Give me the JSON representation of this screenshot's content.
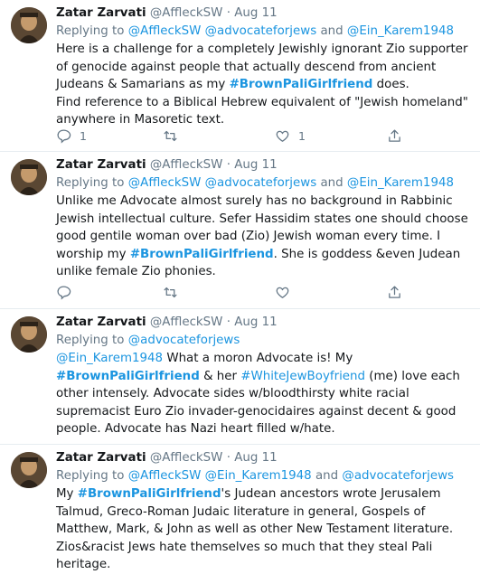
{
  "tweets": [
    {
      "name": "Zatar Zarvati",
      "handle": "@AffleckSW",
      "dot": "·",
      "date": "Aug 11",
      "reply_prefix": "Replying to",
      "reply_handles": [
        "@AffleckSW",
        "@advocateforjews",
        "@Ein_Karem1948"
      ],
      "reply_separators": [
        " ",
        " and "
      ],
      "body": [
        {
          "t": "text",
          "v": "Here is a challenge for a completely Jewishly ignorant Zio supporter of genocide against people that actually descend from ancient Judeans & Samarians as my "
        },
        {
          "t": "tag",
          "v": "#BrownPaliGirlfriend"
        },
        {
          "t": "text",
          "v": " does."
        },
        {
          "t": "br"
        },
        {
          "t": "text",
          "v": "Find reference to a Biblical Hebrew equivalent of \"Jewish homeland\" anywhere in Masoretic text."
        }
      ],
      "counts": {
        "reply": "1",
        "retweet": "",
        "like": "1"
      }
    },
    {
      "name": "Zatar Zarvati",
      "handle": "@AffleckSW",
      "dot": "·",
      "date": "Aug 11",
      "reply_prefix": "Replying to",
      "reply_handles": [
        "@AffleckSW",
        "@advocateforjews",
        "@Ein_Karem1948"
      ],
      "reply_separators": [
        " ",
        " and "
      ],
      "body": [
        {
          "t": "text",
          "v": "Unlike me Advocate almost surely has no background in Rabbinic Jewish intellectual culture. Sefer Hassidim states one should choose good gentile woman over bad (Zio) Jewish woman every time. I worship my "
        },
        {
          "t": "tag",
          "v": "#BrownPaliGirlfriend"
        },
        {
          "t": "text",
          "v": ". She is goddess &even Judean unlike female Zio phonies."
        }
      ],
      "counts": {
        "reply": "",
        "retweet": "",
        "like": ""
      }
    },
    {
      "name": "Zatar Zarvati",
      "handle": "@AffleckSW",
      "dot": "·",
      "date": "Aug 11",
      "reply_prefix": "Replying to",
      "reply_handles": [
        "@advocateforjews"
      ],
      "reply_separators": [],
      "body": [
        {
          "t": "link",
          "v": "@Ein_Karem1948"
        },
        {
          "t": "text",
          "v": " What a moron Advocate is! My "
        },
        {
          "t": "tag",
          "v": "#BrownPaliGirlfriend"
        },
        {
          "t": "text",
          "v": " & her "
        },
        {
          "t": "link",
          "v": "#WhiteJewBoyfriend"
        },
        {
          "t": "text",
          "v": " (me) love each other intensely. Advocate sides w/bloodthirsty white racial supremacist Euro Zio invader-genocidaires against decent & good people. Advocate has Nazi heart filled w/hate."
        }
      ],
      "counts": {
        "reply": "",
        "retweet": "",
        "like": ""
      }
    },
    {
      "name": "Zatar Zarvati",
      "handle": "@AffleckSW",
      "dot": "·",
      "date": "Aug 11",
      "reply_prefix": "Replying to",
      "reply_handles": [
        "@AffleckSW",
        "@Ein_Karem1948",
        "@advocateforjews"
      ],
      "reply_separators": [
        " ",
        " and "
      ],
      "body": [
        {
          "t": "text",
          "v": "My "
        },
        {
          "t": "tag",
          "v": "#BrownPaliGirlfriend"
        },
        {
          "t": "text",
          "v": "'s Judean ancestors wrote Jerusalem Talmud, Greco-Roman Judaic literature in general, Gospels of Matthew, Mark, & John as well as other New Testament literature. Zios&racist Jews hate themselves so much that they steal Pali heritage."
        }
      ],
      "counts": null
    }
  ],
  "colors": {
    "link": "#1b95e0",
    "muted": "#657786",
    "border": "#e6ecf0",
    "text": "#14171a"
  },
  "icons": {
    "reply": "reply-icon",
    "retweet": "retweet-icon",
    "like": "heart-icon",
    "share": "share-icon"
  }
}
